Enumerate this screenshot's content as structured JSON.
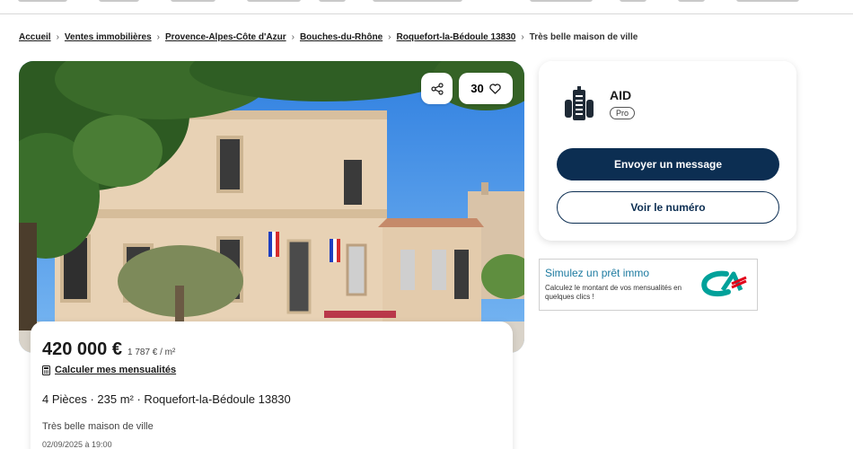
{
  "breadcrumb": [
    {
      "label": "Accueil",
      "link": true
    },
    {
      "label": "Ventes immobilières",
      "link": true
    },
    {
      "label": "Provence-Alpes-Côte d'Azur",
      "link": true
    },
    {
      "label": "Bouches-du-Rhône",
      "link": true
    },
    {
      "label": "Roquefort-la-Bédoule 13830",
      "link": true
    },
    {
      "label": "Très belle maison de ville",
      "link": false
    }
  ],
  "photo": {
    "share_icon": "share-icon",
    "favorites_count": "30",
    "favorite_icon": "heart-icon"
  },
  "listing": {
    "price": "420 000 €",
    "price_per_m2": "1 787 € / m²",
    "calc_label": "Calculer mes mensualités",
    "calc_icon": "calculator-icon",
    "specs": "4 Pièces · 235 m² · Roquefort-la-Bédoule 13830",
    "title": "Très belle maison de ville",
    "date": "02/09/2025 à 19:00"
  },
  "seller": {
    "name": "AID",
    "badge": "Pro",
    "logo_icon": "building-icon",
    "message_label": "Envoyer un message",
    "phone_label": "Voir le numéro"
  },
  "loan_ad": {
    "title": "Simulez un prêt immo",
    "text": "Calculez le montant de vos mensualités en quelques clics !",
    "logo": "credit-agricole-logo"
  },
  "colors": {
    "primary": "#0c2e52",
    "loan_title": "#1c7aa0",
    "ca_green": "#00a19a",
    "ca_red": "#e2001a"
  }
}
